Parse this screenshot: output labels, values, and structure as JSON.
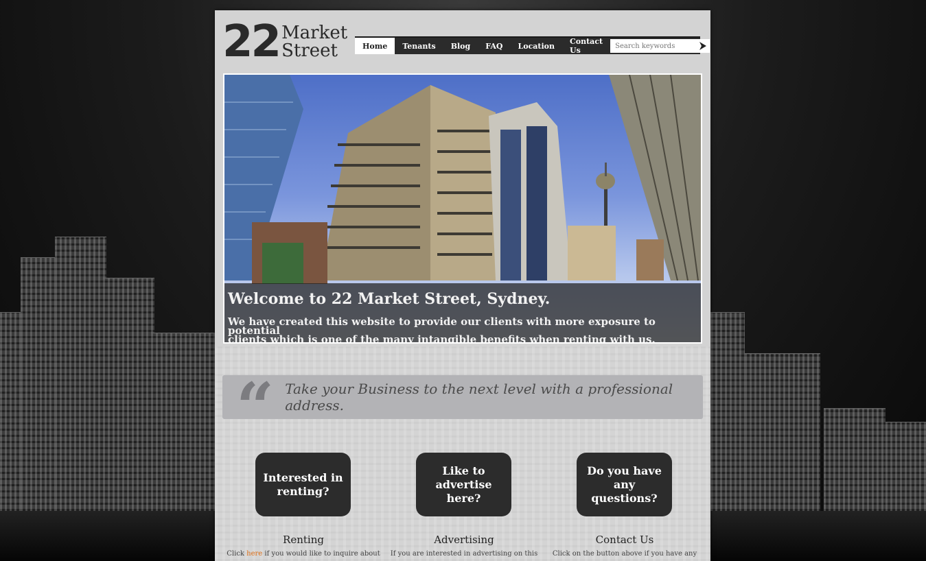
{
  "logo": {
    "number": "22",
    "line1": "Market",
    "line2": "Street"
  },
  "nav": {
    "items": [
      "Home",
      "Tenants",
      "Blog",
      "FAQ",
      "Location",
      "Contact Us"
    ],
    "active_index": 0
  },
  "search": {
    "placeholder": "Search keywords"
  },
  "hero": {
    "title": "Welcome to 22 Market Street, Sydney.",
    "line1": "We have created this website to provide our clients with more exposure to potential",
    "line2": "clients which is one of the many intangible benefits when renting with us."
  },
  "quote": {
    "mark": "“",
    "text": "Take your Business to the next level with a professional address."
  },
  "columns": [
    {
      "button": "Interested in renting?",
      "title": "Renting",
      "text_before": "Click ",
      "link": "here",
      "text_after": " if you would like to inquire about"
    },
    {
      "button": "Like to advertise here?",
      "title": "Advertising",
      "text": "If you are interested in advertising on this"
    },
    {
      "button": "Do you have any questions?",
      "title": "Contact Us",
      "text": "Click on the button above if you have any"
    }
  ],
  "colors": {
    "accent_link": "#e0731c",
    "nav_bg": "#2b2b2b",
    "button_bg": "#2c2c2c"
  },
  "icons": {
    "search_submit": "arrow-right-icon",
    "quote": "quote-mark-icon"
  }
}
